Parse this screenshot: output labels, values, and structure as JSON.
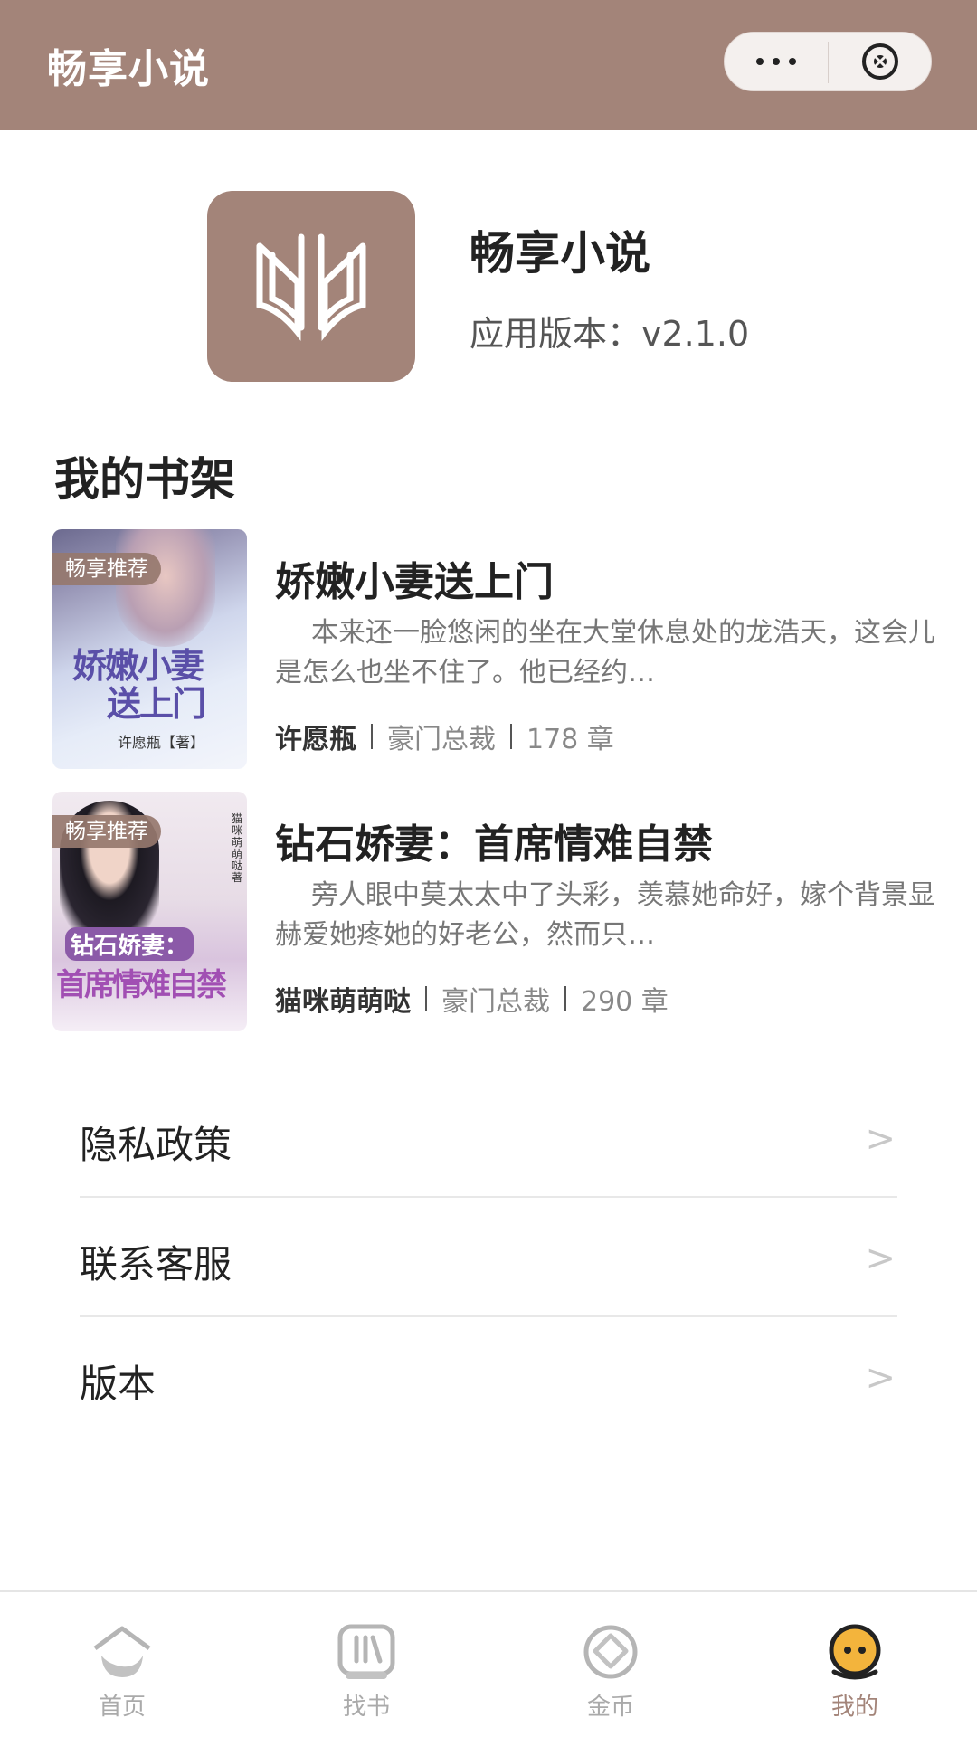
{
  "topbar": {
    "title": "畅享小说"
  },
  "app": {
    "name": "畅享小说",
    "version_label": "应用版本：",
    "version": "v2.1.0"
  },
  "bookshelf": {
    "title": "我的书架",
    "books": [
      {
        "badge": "畅享推荐",
        "cover_text_1": "娇嫩小妻",
        "cover_text_2": "送上门",
        "cover_author": "许愿瓶【著】",
        "title": "娇嫩小妻送上门",
        "desc": "本来还一脸悠闲的坐在大堂休息处的龙浩天，这会儿是怎么也坐不住了。他已经约…",
        "author": "许愿瓶",
        "category": "豪门总裁",
        "chapters": "178 章"
      },
      {
        "badge": "畅享推荐",
        "cover_text_1": "钻石娇妻：",
        "cover_text_2": "首席情难自禁",
        "cover_author": "猫咪萌萌哒 著",
        "title": "钻石娇妻：首席情难自禁",
        "desc": "旁人眼中莫太太中了头彩，羡慕她命好，嫁个背景显赫爱她疼她的好老公，然而只…",
        "author": "猫咪萌萌哒",
        "category": "豪门总裁",
        "chapters": "290 章"
      }
    ]
  },
  "menu": [
    {
      "label": "隐私政策",
      "arrow": ">"
    },
    {
      "label": "联系客服",
      "arrow": ">"
    },
    {
      "label": "版本",
      "arrow": ">"
    }
  ],
  "tabs": [
    {
      "label": "首页",
      "icon": "home-icon",
      "active": false
    },
    {
      "label": "找书",
      "icon": "books-icon",
      "active": false
    },
    {
      "label": "金币",
      "icon": "coin-icon",
      "active": false
    },
    {
      "label": "我的",
      "icon": "profile-icon",
      "active": true
    }
  ],
  "colors": {
    "brand": "#a38479",
    "active_tab": "#a38479",
    "inactive_tab": "#aaaaaa"
  }
}
